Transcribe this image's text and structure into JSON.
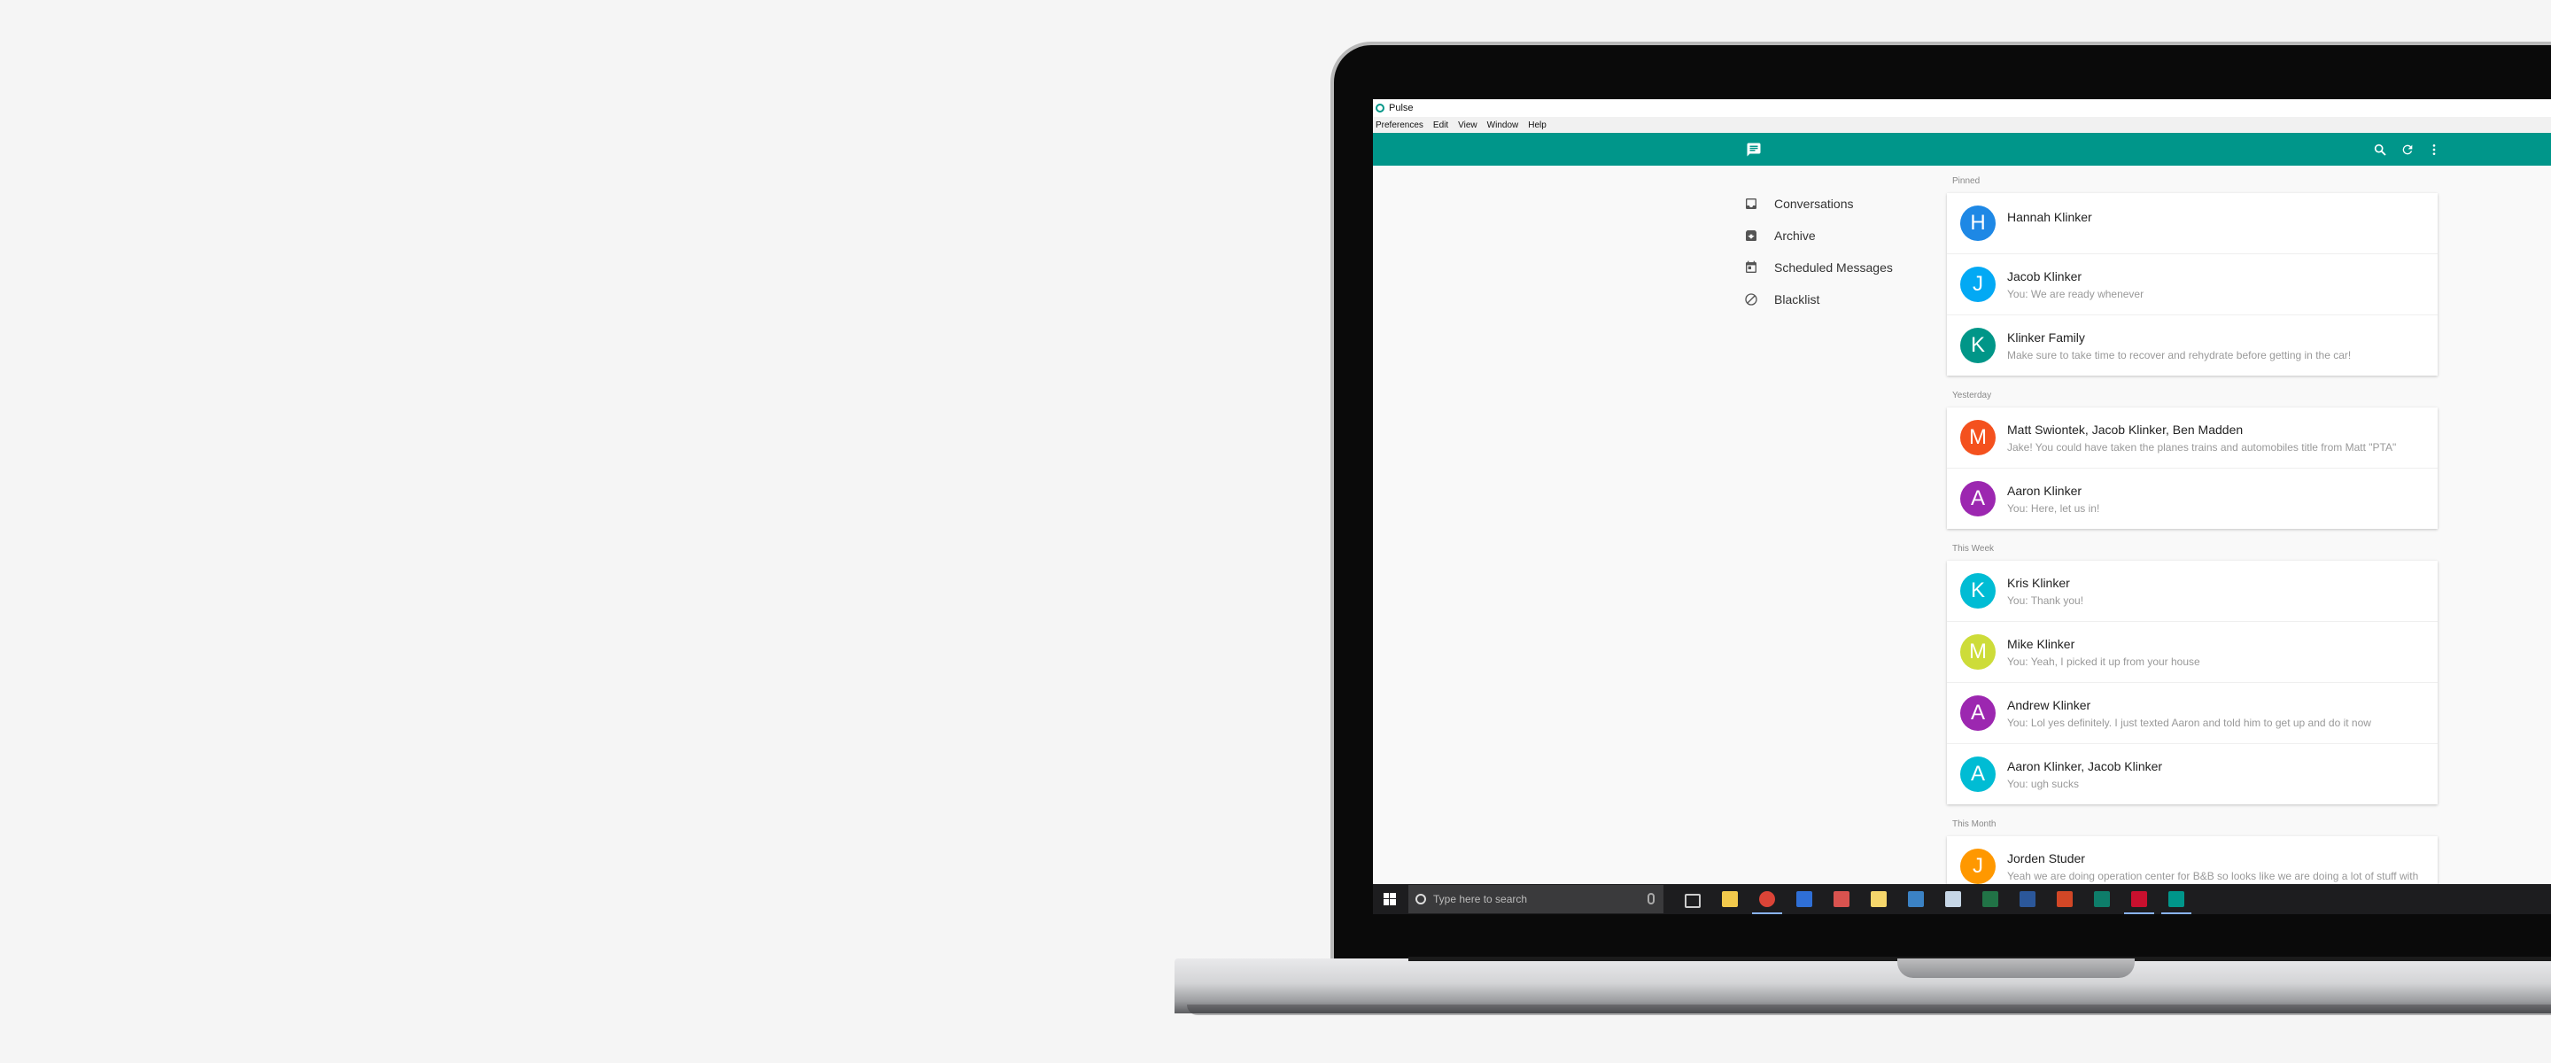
{
  "window": {
    "title": "Pulse"
  },
  "menu": [
    "Preferences",
    "Edit",
    "View",
    "Window",
    "Help"
  ],
  "colors": {
    "accent": "#00968a"
  },
  "toolbar": {
    "icons": [
      "message-icon",
      "search-icon",
      "refresh-icon",
      "more-vert-icon"
    ]
  },
  "nav": [
    {
      "label": "Conversations",
      "icon": "inbox-icon"
    },
    {
      "label": "Archive",
      "icon": "archive-icon"
    },
    {
      "label": "Scheduled Messages",
      "icon": "calendar-icon"
    },
    {
      "label": "Blacklist",
      "icon": "block-icon"
    }
  ],
  "sections": [
    {
      "header": "Pinned",
      "items": [
        {
          "initial": "H",
          "color": "#1e88e5",
          "name": "Hannah Klinker",
          "snippet": ""
        },
        {
          "initial": "J",
          "color": "#03a9f4",
          "name": "Jacob Klinker",
          "snippet": "You: We are ready whenever"
        },
        {
          "initial": "K",
          "color": "#009688",
          "name": "Klinker Family",
          "snippet": "Make sure to take time to recover and rehydrate before getting in the car!"
        }
      ]
    },
    {
      "header": "Yesterday",
      "items": [
        {
          "initial": "M",
          "color": "#f4511e",
          "name": "Matt Swiontek, Jacob Klinker, Ben Madden",
          "snippet": "Jake! You could have taken the planes trains and automobiles title from Matt \"PTA\""
        },
        {
          "initial": "A",
          "color": "#9c27b0",
          "name": "Aaron Klinker",
          "snippet": "You: Here, let us in!"
        }
      ]
    },
    {
      "header": "This Week",
      "items": [
        {
          "initial": "K",
          "color": "#00bcd4",
          "name": "Kris Klinker",
          "snippet": "You: Thank you!"
        },
        {
          "initial": "M",
          "color": "#cddc39",
          "name": "Mike Klinker",
          "snippet": "You: Yeah, I picked it up from your house"
        },
        {
          "initial": "A",
          "color": "#9c27b0",
          "name": "Andrew Klinker",
          "snippet": "You: Lol yes definitely. I just texted Aaron and told him to get up and do it now"
        },
        {
          "initial": "A",
          "color": "#00bcd4",
          "name": "Aaron Klinker, Jacob Klinker",
          "snippet": "You: ugh sucks"
        }
      ]
    },
    {
      "header": "This Month",
      "items": [
        {
          "initial": "J",
          "color": "#ff9800",
          "name": "Jorden Studer",
          "snippet": "Yeah we are doing operation center for B&B so looks like we are doing a lot of stuff with"
        }
      ]
    }
  ],
  "taskbar": {
    "search_placeholder": "Type here to search",
    "apps": [
      "task-view-icon",
      "file-explorer-icon",
      "chrome-icon",
      "calendar-app-icon",
      "pdf-icon",
      "notes-icon",
      "messaging-icon",
      "paint-icon",
      "excel-icon",
      "word-icon",
      "powerpoint-icon",
      "publisher-icon",
      "shield-app-icon",
      "pulse-app-icon"
    ]
  }
}
